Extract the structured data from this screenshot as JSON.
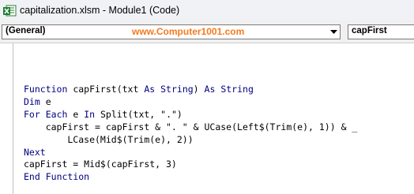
{
  "window": {
    "title": "capitalization.xlsm - Module1 (Code)",
    "app_icon": "excel-icon"
  },
  "toolbar": {
    "object_combo": "(General)",
    "procedure_combo": "capFirst",
    "watermark": "www.Computer1001.com"
  },
  "code": {
    "lines": [
      {
        "tokens": [
          {
            "t": "Function",
            "kw": true
          },
          {
            "t": " capFirst(txt ",
            "kw": false
          },
          {
            "t": "As",
            "kw": true
          },
          {
            "t": " ",
            "kw": false
          },
          {
            "t": "String",
            "kw": true
          },
          {
            "t": ") ",
            "kw": false
          },
          {
            "t": "As",
            "kw": true
          },
          {
            "t": " ",
            "kw": false
          },
          {
            "t": "String",
            "kw": true
          }
        ]
      },
      {
        "tokens": [
          {
            "t": "Dim",
            "kw": true
          },
          {
            "t": " e",
            "kw": false
          }
        ]
      },
      {
        "tokens": [
          {
            "t": "For",
            "kw": true
          },
          {
            "t": " ",
            "kw": false
          },
          {
            "t": "Each",
            "kw": true
          },
          {
            "t": " e ",
            "kw": false
          },
          {
            "t": "In",
            "kw": true
          },
          {
            "t": " Split(txt, \".\")",
            "kw": false
          }
        ]
      },
      {
        "tokens": [
          {
            "t": "    capFirst = capFirst & \". \" & UCase(Left$(Trim(e), 1)) & _",
            "kw": false
          }
        ]
      },
      {
        "tokens": [
          {
            "t": "        LCase(Mid$(Trim(e), 2))",
            "kw": false
          }
        ]
      },
      {
        "tokens": [
          {
            "t": "Next",
            "kw": true
          }
        ]
      },
      {
        "tokens": [
          {
            "t": "capFirst = Mid$(capFirst, 3)",
            "kw": false
          }
        ]
      },
      {
        "tokens": [
          {
            "t": "End",
            "kw": true
          },
          {
            "t": " ",
            "kw": false
          },
          {
            "t": "Function",
            "kw": true
          }
        ]
      }
    ]
  },
  "colors": {
    "keyword": "#00007f",
    "watermark": "#f47a1f"
  }
}
